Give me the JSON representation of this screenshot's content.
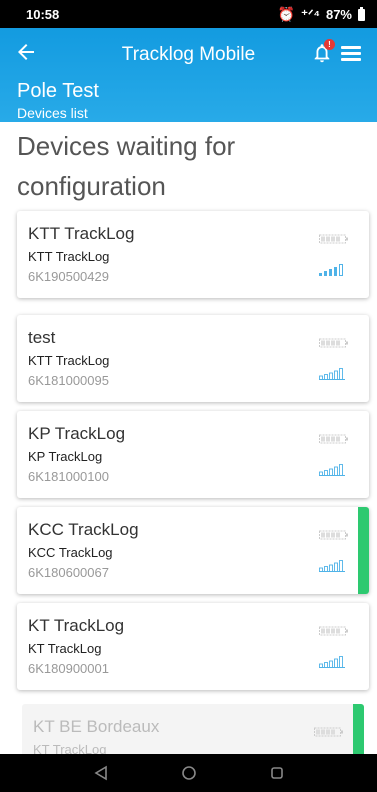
{
  "status_bar": {
    "time": "10:58",
    "alarm_icon": "alarm-clock-icon",
    "signal_text": "⁺ᐟ⁴",
    "battery_percent": "87%"
  },
  "header": {
    "title": "Tracklog Mobile",
    "project": "Pole Test",
    "subtitle": "Devices list",
    "notification_badge": "!"
  },
  "main": {
    "heading": "Devices waiting for configuration"
  },
  "devices": [
    {
      "name": "KTT TrackLog",
      "model": "KTT TrackLog",
      "serial": "6K190500429",
      "signal": "bars",
      "highlighted": false
    },
    {
      "name": "test",
      "model": "KTT TrackLog",
      "serial": "6K181000095",
      "signal": "empty",
      "highlighted": false
    },
    {
      "name": "KP TrackLog",
      "model": "KP TrackLog",
      "serial": "6K181000100",
      "signal": "empty",
      "highlighted": false
    },
    {
      "name": "KCC TrackLog",
      "model": "KCC TrackLog",
      "serial": "6K180600067",
      "signal": "empty",
      "highlighted": true
    },
    {
      "name": "KT TrackLog",
      "model": "KT TrackLog",
      "serial": "6K180900001",
      "signal": "empty",
      "highlighted": false
    },
    {
      "name": "KT BE Bordeaux",
      "model": "KT TrackLog",
      "serial": "",
      "signal": "none",
      "highlighted": true
    }
  ],
  "colors": {
    "header": "#1fa3e5",
    "accent": "#2dc970",
    "signal": "#4fb3e8"
  }
}
